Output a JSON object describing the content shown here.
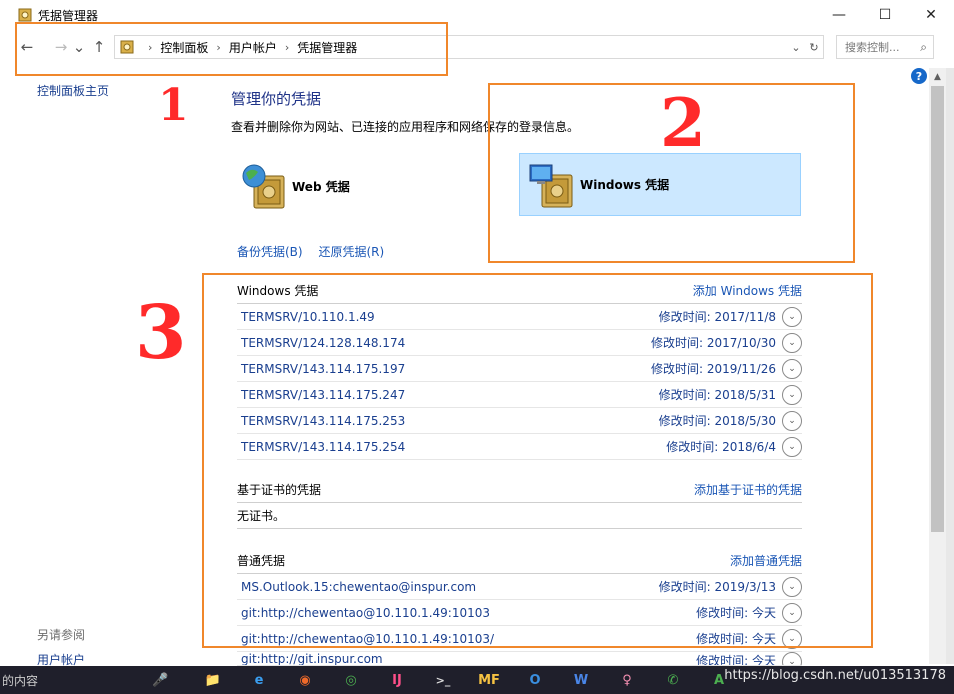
{
  "window": {
    "title": "凭据管理器",
    "min": "—",
    "max": "☐",
    "close": "✕"
  },
  "nav": {
    "back": "←",
    "forward": "→",
    "recent": "⌄",
    "up": "↑",
    "breadcrumb": [
      "控制面板",
      "用户帐户",
      "凭据管理器"
    ],
    "dropdown": "⌄",
    "refresh": "↻",
    "search_placeholder": "搜索控制..."
  },
  "sidebar": {
    "home_link": "控制面板主页",
    "see_also": "另请参阅",
    "user_accounts": "用户帐户"
  },
  "main": {
    "title": "管理你的凭据",
    "description": "查看并删除你为网站、已连接的应用程序和网络保存的登录信息。",
    "web_credentials": "Web 凭据",
    "windows_credentials": "Windows 凭据",
    "backup": "备份凭据(B)",
    "restore": "还原凭据(R)"
  },
  "windows_section": {
    "heading": "Windows 凭据",
    "add": "添加 Windows 凭据",
    "rows": [
      {
        "name": "TERMSRV/10.110.1.49",
        "modified": "修改时间:  2017/11/8"
      },
      {
        "name": "TERMSRV/124.128.148.174",
        "modified": "修改时间:  2017/10/30"
      },
      {
        "name": "TERMSRV/143.114.175.197",
        "modified": "修改时间:  2019/11/26"
      },
      {
        "name": "TERMSRV/143.114.175.247",
        "modified": "修改时间:  2018/5/31"
      },
      {
        "name": "TERMSRV/143.114.175.253",
        "modified": "修改时间:  2018/5/30"
      },
      {
        "name": "TERMSRV/143.114.175.254",
        "modified": "修改时间:  2018/6/4"
      }
    ]
  },
  "cert_section": {
    "heading": "基于证书的凭据",
    "add": "添加基于证书的凭据",
    "empty": "无证书。"
  },
  "generic_section": {
    "heading": "普通凭据",
    "add": "添加普通凭据",
    "rows": [
      {
        "name": "MS.Outlook.15:chewentao@inspur.com",
        "modified": "修改时间:  2019/3/13"
      },
      {
        "name": "git:http://chewentao@10.110.1.49:10103",
        "modified": "修改时间:  今天"
      },
      {
        "name": "git:http://chewentao@10.110.1.49:10103/",
        "modified": "修改时间:  今天"
      },
      {
        "name": "git:http://git.inspur.com",
        "modified": "修改时间:  今天"
      }
    ]
  },
  "annotations": [
    "1",
    "2",
    "3"
  ],
  "taskbar": {
    "search_text": "的内容",
    "mic": "🎤",
    "apps": [
      "📁",
      "e",
      "◉",
      "◎",
      "IJ",
      ">_",
      "MF",
      "O",
      "W",
      "♀",
      "✆",
      "A"
    ],
    "watermark": "https://blog.csdn.net/u013513178"
  },
  "colors": {
    "accent": "#1a56b5",
    "selection": "#cce8ff",
    "annotation": "#ff2a2a",
    "box": "#f0872b"
  }
}
